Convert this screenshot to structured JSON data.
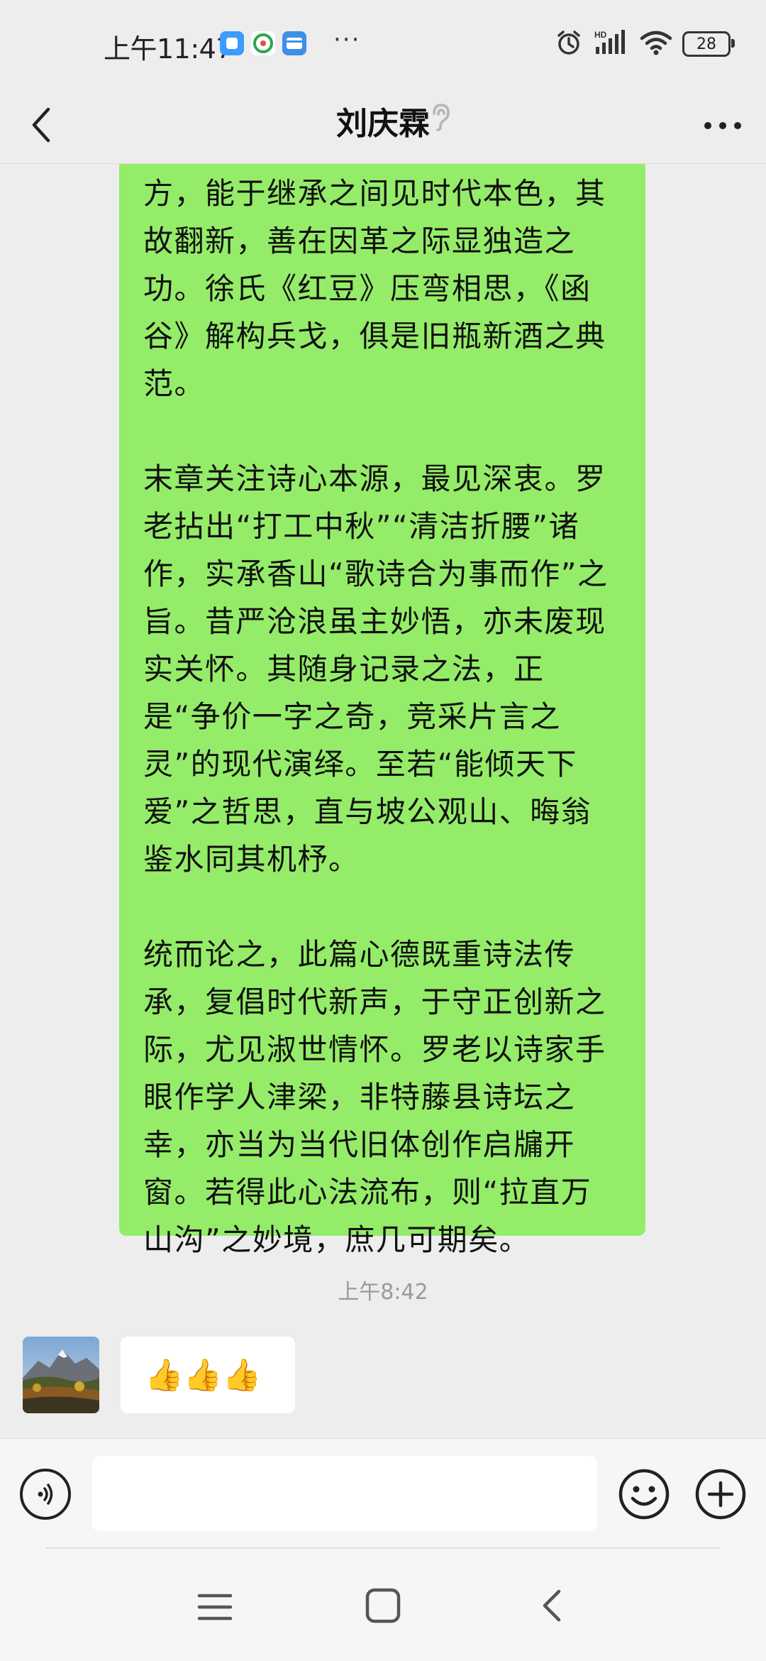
{
  "status_bar": {
    "time": "上午11:47",
    "overflow": "···",
    "battery": "28",
    "icons": [
      "app-notification-icon",
      "mobile-app-icon",
      "wallet-icon",
      "alarm-icon",
      "hd-signal-icon",
      "wifi-icon",
      "battery-icon"
    ]
  },
  "header": {
    "title": "刘庆霖",
    "icons": [
      "back-chevron-icon",
      "earpiece-icon",
      "more-icon"
    ]
  },
  "messages": {
    "sent_paragraphs": [
      "方，能于继承之间见时代本色，其故翻新，善在因革之际显独造之功。徐氏《红豆》压弯相思，《函谷》解构兵戈，俱是旧瓶新酒之典范。",
      "末章关注诗心本源，最见深衷。罗老拈出“打工中秋”“清洁折腰”诸作，实承香山“歌诗合为事而作”之旨。昔严沧浪虽主妙悟，亦未废现实关怀。其随身记录之法，正是“争价一字之奇，竞采片言之灵”的现代演绎。至若“能倾天下爱”之哲思，直与坡公观山、晦翁鉴水同其机杼。",
      "统而论之，此篇心德既重诗法传承，复倡时代新声，于守正创新之际，尤见淑世情怀。罗老以诗家手眼作学人津梁，非特藤县诗坛之幸，亦当为当代旧体创作启牖开窗。若得此心法流布，则“拉直万山沟”之妙境，庶几可期矣。"
    ],
    "timestamp": "上午8:42",
    "received_text": "👍👍👍"
  },
  "input_bar": {
    "value": "",
    "placeholder": ""
  },
  "colors": {
    "sent_bubble": "#95ec69",
    "chat_background": "#ededed",
    "received_bubble": "#ffffff"
  }
}
